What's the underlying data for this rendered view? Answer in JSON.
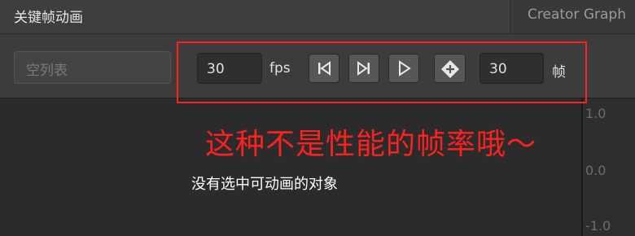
{
  "tabs": {
    "active_label": "关键帧动画",
    "other_label": "Creator Graph"
  },
  "toolbar": {
    "clip_placeholder": "空列表",
    "sample_value": "30",
    "sample_unit": "fps",
    "buttons": [
      {
        "icon": "jump-to-first-frame-icon"
      },
      {
        "icon": "jump-to-last-frame-icon"
      },
      {
        "icon": "play-icon"
      },
      {
        "icon": "add-keyframe-icon"
      }
    ],
    "frame_value": "30",
    "frame_unit": "帧"
  },
  "annotation": {
    "text": "这种不是性能的帧率哦～",
    "color": "#ff2020"
  },
  "main": {
    "empty_message": "没有选中可动画的对象"
  },
  "curve_axis": {
    "labels": [
      "1.0",
      "0.0",
      "-1.0"
    ]
  }
}
